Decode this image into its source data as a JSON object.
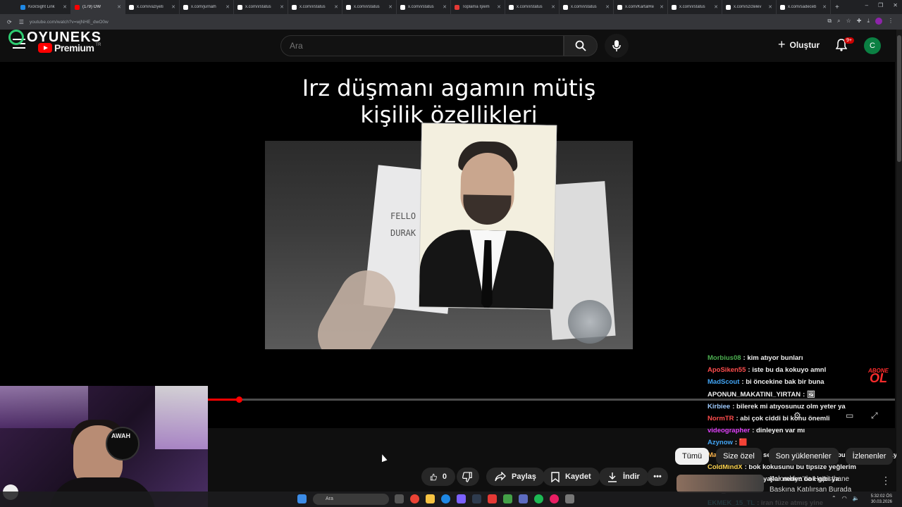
{
  "browser": {
    "tabs": [
      {
        "label": "KickSight Link",
        "fav": "#1e88e5"
      },
      {
        "label": "(179) OW",
        "fav": "#ff0000",
        "active": true
      },
      {
        "label": "x.com/vaziyeti",
        "fav": "#ffffff"
      },
      {
        "label": "x.com/jurnalh",
        "fav": "#ffffff"
      },
      {
        "label": "x.com/i/status",
        "fav": "#ffffff"
      },
      {
        "label": "x.com/i/status",
        "fav": "#ffffff"
      },
      {
        "label": "x.com/i/status",
        "fav": "#ffffff"
      },
      {
        "label": "x.com/i/status",
        "fav": "#ffffff"
      },
      {
        "label": "Toplama İşlem",
        "fav": "#e53935"
      },
      {
        "label": "x.com/i/status",
        "fav": "#ffffff"
      },
      {
        "label": "x.com/i/status",
        "fav": "#ffffff"
      },
      {
        "label": "x.com/KartalRe",
        "fav": "#ffffff"
      },
      {
        "label": "x.com/i/status",
        "fav": "#ffffff"
      },
      {
        "label": "x.com/szctelev",
        "fav": "#ffffff"
      },
      {
        "label": "x.com/sadeceb",
        "fav": "#ffffff"
      }
    ],
    "url": "youtube.com/watch?v=wjNHE_dwO0w",
    "new_tab": "+",
    "window_controls": [
      "–",
      "❐",
      "✕"
    ]
  },
  "youtube": {
    "brand": {
      "name": "OYUNEKS",
      "product": "Premium",
      "region": "TR"
    },
    "search_placeholder": "Ara",
    "create_label": "Oluştur",
    "notif_badge": "9+",
    "avatar_letter": "C"
  },
  "video": {
    "title_line1": "Irz düşmanı agamın mütiş",
    "title_line2": "kişilik özellikleri",
    "paper_text_line1": "FELLO",
    "paper_text_line2": "DURAK",
    "progress_fraction": 0.045
  },
  "actions": {
    "like_count": "0",
    "share": "Paylaş",
    "save": "Kaydet",
    "download": "İndir"
  },
  "chips": [
    "Tümü",
    "Size özel",
    "Son yüklenenler",
    "İzlenenler"
  ],
  "recommendation": {
    "line1": "Kolombiya'da Hapisthane",
    "line2": "Baskına Katılırsan Burada"
  },
  "webcam": {
    "mic_brand": "AWAH"
  },
  "overlay": {
    "abone": "ABONE",
    "ol": "OL"
  },
  "chat": [
    {
      "user": "Morbius08",
      "color": "#4caf50",
      "text": ": kim atıyor bunları"
    },
    {
      "user": "ApoSiken55",
      "color": "#ff4d4d",
      "text": ": iste bu da kokuyo amnl"
    },
    {
      "user": "MadScout",
      "color": "#42a5f5",
      "text": ": bi öncekine bak bir buna"
    },
    {
      "user": "APONUN_MAKATINI_YIRTAN",
      "color": "#f1f1f1",
      "text": ": 🖼"
    },
    {
      "user": "Kirbiee",
      "color": "#9ecbff",
      "text": ": bilerek mi atıyosunuz olm yeter ya"
    },
    {
      "user": "NormTR",
      "color": "#ff4d4d",
      "text": ": abi çok ciddi bi konu önemli"
    },
    {
      "user": "videographer",
      "color": "#e040fb",
      "text": ": dinleyen var mı"
    },
    {
      "user": "Azynow",
      "color": "#42a5f5",
      "text": ": 🟥"
    },
    {
      "user": "Matias0738",
      "color": "#ffb74d",
      "text": ": kral sen sonren diye geliyo bu linkler valla baydi"
    },
    {
      "user": "ColdMindX",
      "color": "#ffd54f",
      "text": ": bok kokusunu bu tipsize yeğlerim"
    },
    {
      "user": "Crashee",
      "color": "#ff4d4d",
      "text": ": şu makyajlar neden bok gibi ya"
    },
    {
      "user": "Kael_Live",
      "color": "#f1f1f1",
      "text": ":"
    },
    {
      "user": "EKMEK_15_TL",
      "color": "#4dd0e1",
      "text": ": iran füze atmış yine"
    }
  ],
  "taskbar": {
    "search": "Ara",
    "time": "5:32:02 ÖS",
    "date": "30.03.2026"
  }
}
